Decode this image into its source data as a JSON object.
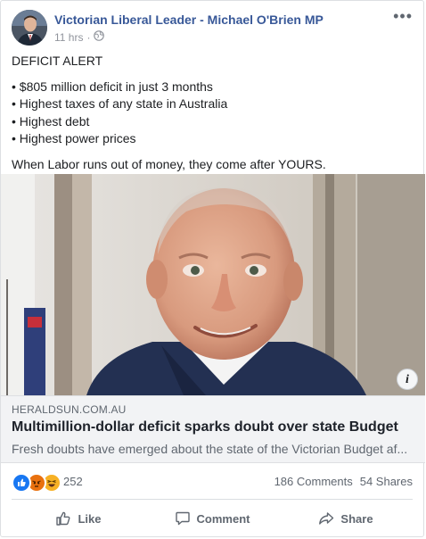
{
  "post": {
    "page_name": "Victorian Liberal Leader - Michael O'Brien MP",
    "timestamp": "11 hrs",
    "separator": "·",
    "audience_icon": "globe-icon",
    "more_options": "•••"
  },
  "body": {
    "headline": "DEFICIT ALERT",
    "bullets": [
      "• $805 million deficit in just 3 months",
      "• Highest taxes of any state in Australia",
      "• Highest debt",
      "• Highest power prices"
    ],
    "closing": "When Labor runs out of money, they come after YOURS."
  },
  "link_preview": {
    "info_label": "i",
    "domain": "HERALDSUN.COM.AU",
    "title": "Multimillion-dollar deficit sparks doubt over state Budget",
    "description": "Fresh doubts have emerged about the state of the Victorian Budget af..."
  },
  "reactions": {
    "icons": [
      "like-reaction-icon",
      "angry-reaction-icon",
      "haha-reaction-icon"
    ],
    "count": "252",
    "comments": "186 Comments",
    "shares": "54 Shares"
  },
  "actions": {
    "like": "Like",
    "comment": "Comment",
    "share": "Share"
  },
  "colors": {
    "link_blue": "#385898",
    "meta_gray": "#90949c",
    "action_gray": "#606770",
    "like_blue": "#1877f2",
    "angry_orange": "#e9710f",
    "haha_yellow": "#f7b125"
  }
}
